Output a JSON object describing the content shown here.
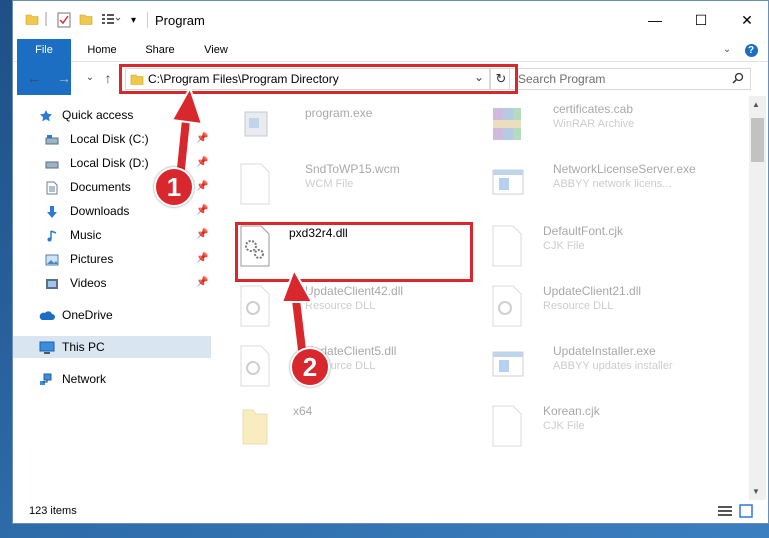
{
  "window": {
    "title": "Program",
    "controls": {
      "minimize": "—",
      "maximize": "☐",
      "close": "✕"
    }
  },
  "ribbon": {
    "tabs": [
      "File",
      "Home",
      "Share",
      "View"
    ],
    "help": "?"
  },
  "address": {
    "path": "C:\\Program Files\\Program Directory",
    "dropdown": "⌄",
    "refresh": "↻"
  },
  "search": {
    "placeholder": "Search Program",
    "icon": "search-icon"
  },
  "nav": {
    "back": "←",
    "forward": "→",
    "recent": "⌄",
    "up": "↑",
    "quick_access": "Quick access",
    "pinned": [
      "Local Disk (C:)",
      "Local Disk (D:)",
      "Documents",
      "Downloads",
      "Music",
      "Pictures",
      "Videos"
    ],
    "onedrive": "OneDrive",
    "this_pc": "This PC",
    "network": "Network"
  },
  "files": [
    {
      "name": "program.exe",
      "type": ""
    },
    {
      "name": "certificates.cab",
      "type": "WinRAR Archive"
    },
    {
      "name": "SndToWP15.wcm",
      "type": "WCM File"
    },
    {
      "name": "NetworkLicenseServer.exe",
      "type": "ABBYY network licens..."
    },
    {
      "name": "pxd32r4.dll",
      "type": ""
    },
    {
      "name": "DefaultFont.cjk",
      "type": "CJK File"
    },
    {
      "name": "UpdateClient42.dll",
      "type": "Resource DLL"
    },
    {
      "name": "UpdateClient21.dll",
      "type": "Resource DLL"
    },
    {
      "name": "UpdateClient5.dll",
      "type": "Resource DLL"
    },
    {
      "name": "UpdateInstaller.exe",
      "type": "ABBYY updates installer"
    },
    {
      "name": "x64",
      "type": ""
    },
    {
      "name": "Korean.cjk",
      "type": "CJK File"
    }
  ],
  "status": {
    "item_count": "123 items"
  },
  "annotations": {
    "step1": "1",
    "step2": "2"
  },
  "colors": {
    "accent": "#1b6ec2",
    "highlight": "#d9272e",
    "selected": "#d9e6f2"
  }
}
